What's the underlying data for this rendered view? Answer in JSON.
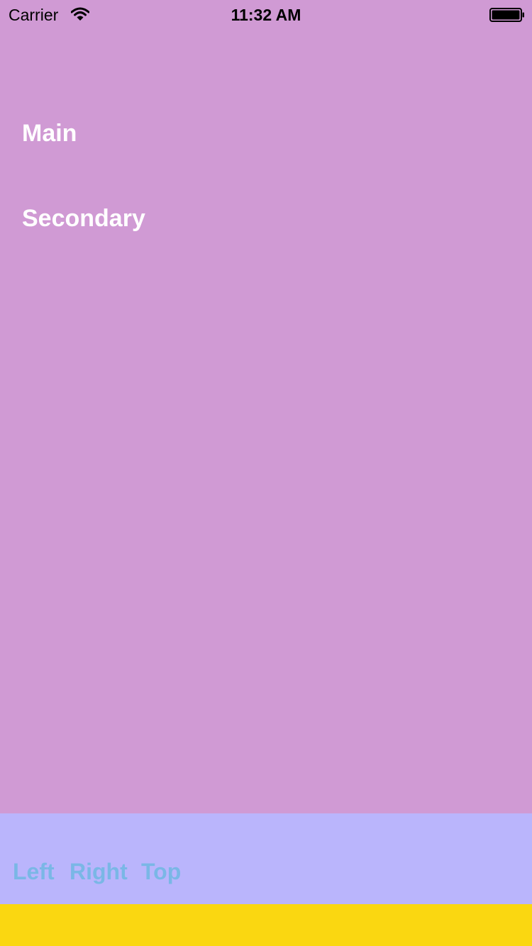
{
  "status_bar": {
    "carrier": "Carrier",
    "time": "11:32 AM",
    "icons": [
      "wifi-icon",
      "battery-icon"
    ]
  },
  "menu": {
    "items": [
      {
        "label": "Main"
      },
      {
        "label": "Secondary"
      }
    ]
  },
  "bottom_bar": {
    "buttons": [
      {
        "label": "Left"
      },
      {
        "label": "Right"
      },
      {
        "label": "Top"
      }
    ]
  },
  "colors": {
    "background": "#d09ad4",
    "bottom_bar": "#bab5fc",
    "button_text": "#7ab7e6",
    "footer_strip": "#fad711",
    "menu_text": "#ffffff"
  }
}
